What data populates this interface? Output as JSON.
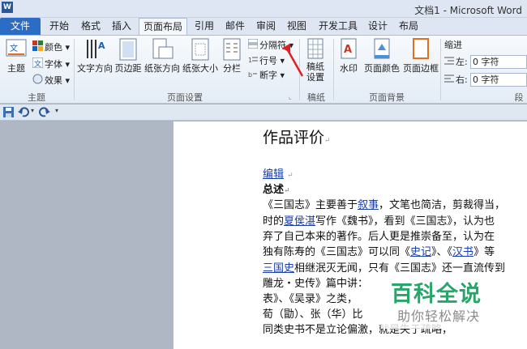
{
  "window": {
    "title": "文档1 - Microsoft Word",
    "logo": "W"
  },
  "tabs": [
    "文件",
    "开始",
    "格式",
    "插入",
    "页面布局",
    "引用",
    "邮件",
    "审阅",
    "视图",
    "开发工具",
    "设计",
    "布局"
  ],
  "ribbon": {
    "theme_group": {
      "label": "主题",
      "theme": "主题",
      "colors": "颜色",
      "fonts": "字体",
      "effects": "效果"
    },
    "page_setup": {
      "label": "页面设置",
      "text_direction": "文字方向",
      "margins": "页边距",
      "orientation": "纸张方向",
      "size": "纸张大小",
      "columns": "分栏",
      "breaks": "分隔符",
      "line_numbers": "行号",
      "hyphenation": "断字"
    },
    "paper_group": {
      "label": "稿纸",
      "button": "稿纸设置"
    },
    "page_background": {
      "label": "页面背景",
      "watermark": "水印",
      "page_color": "页面颜色",
      "page_borders": "页面边框"
    },
    "paragraph": {
      "indent_label": "缩进",
      "left_label": "左:",
      "left_value": "0 字符",
      "right_label": "右:",
      "right_value": "0 字符",
      "group_cut": "段"
    }
  },
  "document": {
    "title": "作品评价",
    "edit_link": "编辑",
    "heading": "总述",
    "lines": [
      "《三国志》主要善于叙事，文笔也简洁，剪裁得当，",
      "时的夏侯湛写作《魏书》，看到《三国志》，认为也",
      "弃了自己本来的著作。后人更是推崇备至，认为在",
      "独有陈寿的《三国志》可以同《史记》、《汉书》等",
      "三国史相继泯灭无闻，只有《三国志》还一直流传到",
      "雕龙・史传》篇中讲：",
      "表》、《吴录》之类，",
      "荀（勖）、张（华）比",
      "同类史书不是立论偏激，就是失于疏略，"
    ]
  },
  "watermark": {
    "main": "百科全说",
    "sub": "助你轻松解决"
  },
  "colors": {
    "accent": "#2b6cc4",
    "link": "#1a3ea8",
    "arrow": "#e02020",
    "watermark_green": "#2aa56a"
  }
}
